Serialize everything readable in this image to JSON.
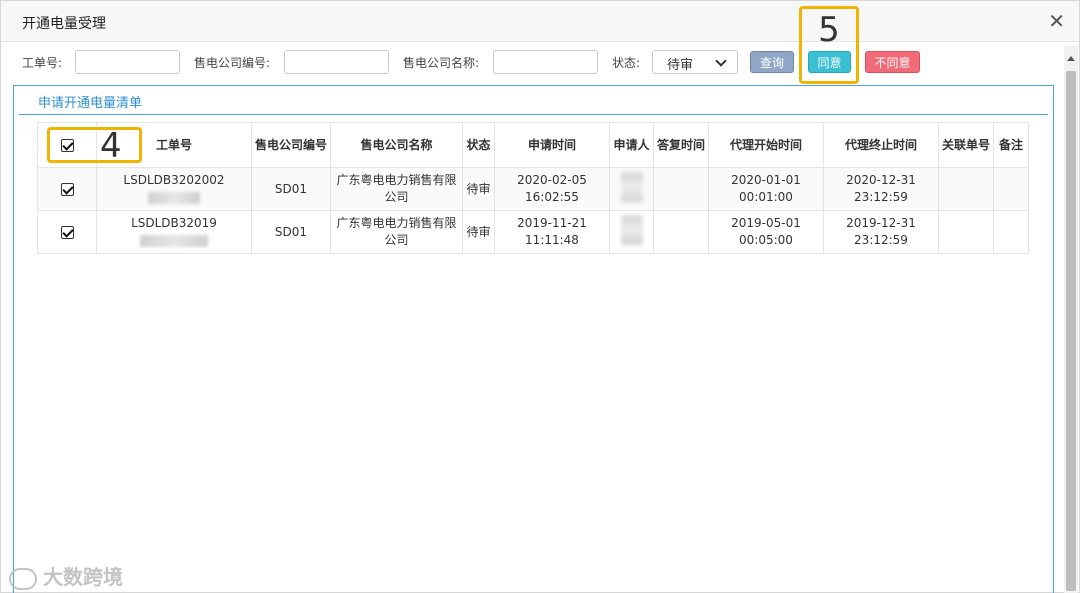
{
  "dialog": {
    "title": "开通电量受理",
    "close_icon": "✕"
  },
  "toolbar": {
    "order_no_label": "工单号:",
    "company_code_label": "售电公司编号:",
    "company_name_label": "售电公司名称:",
    "status_label": "状态:",
    "status_value": "待审",
    "query_label": "查询",
    "agree_label": "同意",
    "disagree_label": "不同意"
  },
  "callouts": {
    "step5": "5",
    "step4": "4"
  },
  "panel": {
    "title": "申请开通电量清单"
  },
  "table": {
    "columns": [
      "工单号",
      "售电公司编号",
      "售电公司名称",
      "状态",
      "申请时间",
      "申请人",
      "答复时间",
      "代理开始时间",
      "代理终止时间",
      "关联单号",
      "备注"
    ],
    "header_checked": true,
    "rows": [
      {
        "checked": true,
        "order_no": "LSDLDB3202002",
        "company_code": "SD01",
        "company_name": "广东粤电电力销售有限公司",
        "status": "待审",
        "apply_time": "2020-02-05 16:02:55",
        "applicant": "",
        "reply_time": "",
        "start_time": "2020-01-01 00:01:00",
        "end_time": "2020-12-31 23:12:59",
        "related_no": "",
        "remark": ""
      },
      {
        "checked": true,
        "order_no": "LSDLDB32019",
        "company_code": "SD01",
        "company_name": "广东粤电电力销售有限公司",
        "status": "待审",
        "apply_time": "2019-11-21 11:11:48",
        "applicant": "",
        "reply_time": "",
        "start_time": "2019-05-01 00:05:00",
        "end_time": "2019-12-31 23:12:59",
        "related_no": "",
        "remark": ""
      }
    ]
  },
  "watermark": {
    "text": "大数跨境"
  }
}
